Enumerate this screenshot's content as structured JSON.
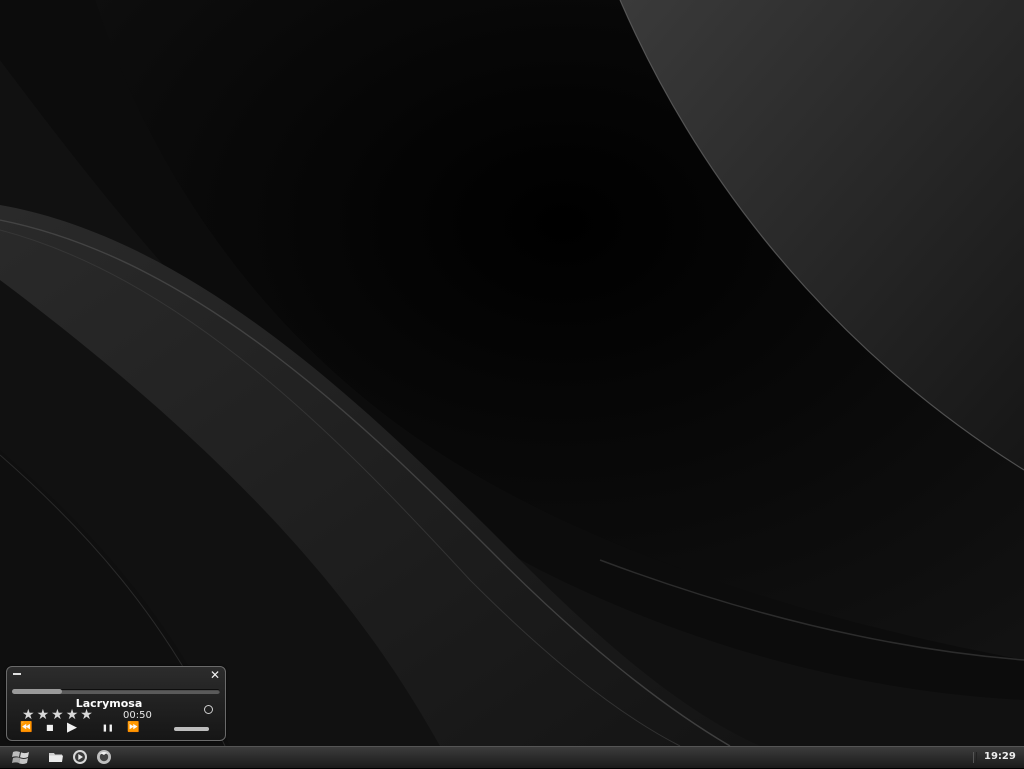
{
  "media_player": {
    "track_title": "Lacrymosa",
    "elapsed_time": "00:50",
    "rating_stars": [
      "★",
      "★",
      "★",
      "★",
      "★"
    ],
    "progress_fraction": 0.24,
    "volume_fraction": 1.0,
    "controls": {
      "rewind": "⏪",
      "stop": "■",
      "play": "▶",
      "pause": "❚❚",
      "fast_forward": "⏩"
    }
  },
  "taskbar": {
    "clock": "19:29",
    "start_icon": "windows-logo-icon",
    "quick_launch": [
      "folder-icon",
      "media-player-icon",
      "browser-icon"
    ]
  },
  "colors": {
    "desktop_background": "#000000",
    "player_text": "#ffffff",
    "taskbar": "#2a2a2a"
  }
}
